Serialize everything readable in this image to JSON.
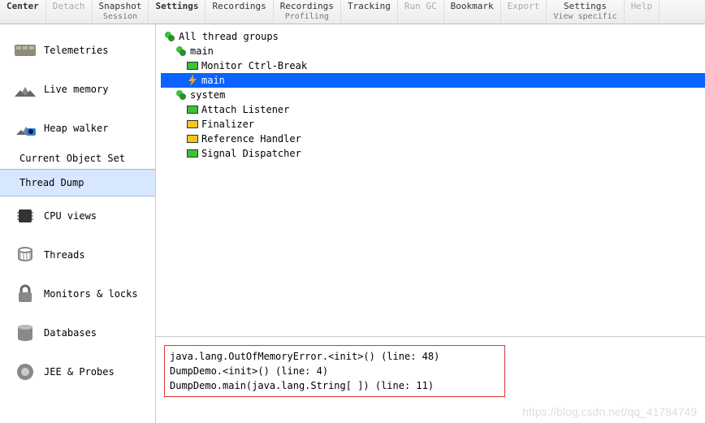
{
  "topbar": [
    {
      "label": "Center",
      "sub": "",
      "bold": true
    },
    {
      "label": "Detach",
      "sub": "",
      "faded": true
    },
    {
      "label": "Snapshot",
      "sub": "Session"
    },
    {
      "label": "Settings",
      "sub": "",
      "bold": true
    },
    {
      "label": "Recordings",
      "sub": ""
    },
    {
      "label": "Recordings",
      "sub": "Profiling"
    },
    {
      "label": "Tracking",
      "sub": ""
    },
    {
      "label": "Run GC",
      "sub": "",
      "faded": true
    },
    {
      "label": "Bookmark",
      "sub": ""
    },
    {
      "label": "Export",
      "sub": "",
      "faded": true
    },
    {
      "label": "Settings",
      "sub": "View specific"
    },
    {
      "label": "Help",
      "sub": "",
      "faded": true
    }
  ],
  "sidebar": {
    "items": [
      {
        "label": "Telemetries",
        "icon": "telemetry-icon"
      },
      {
        "label": "Live memory",
        "icon": "livememory-icon"
      },
      {
        "label": "Heap walker",
        "icon": "heapwalker-icon"
      }
    ],
    "section_header": "Current Object Set",
    "selected": {
      "label": "Thread Dump"
    },
    "items2": [
      {
        "label": "CPU views",
        "icon": "cpu-icon"
      },
      {
        "label": "Threads",
        "icon": "threads-icon"
      },
      {
        "label": "Monitors & locks",
        "icon": "lock-icon"
      },
      {
        "label": "Databases",
        "icon": "database-icon"
      },
      {
        "label": "JEE & Probes",
        "icon": "probes-icon"
      }
    ]
  },
  "tree": {
    "root": "All thread groups",
    "groups": [
      {
        "name": "main",
        "threads": [
          {
            "name": "Monitor Ctrl-Break",
            "state": "green",
            "selected": false
          },
          {
            "name": "main",
            "state": "bolt",
            "selected": true
          }
        ]
      },
      {
        "name": "system",
        "threads": [
          {
            "name": "Attach Listener",
            "state": "green"
          },
          {
            "name": "Finalizer",
            "state": "yellow"
          },
          {
            "name": "Reference Handler",
            "state": "yellow"
          },
          {
            "name": "Signal Dispatcher",
            "state": "green"
          }
        ]
      }
    ]
  },
  "stack": [
    "java.lang.OutOfMemoryError.<init>() (line: 48)",
    "DumpDemo.<init>() (line: 4)",
    "DumpDemo.main(java.lang.String[ ]) (line: 11)"
  ],
  "watermark": "https://blog.csdn.net/qq_41784749"
}
